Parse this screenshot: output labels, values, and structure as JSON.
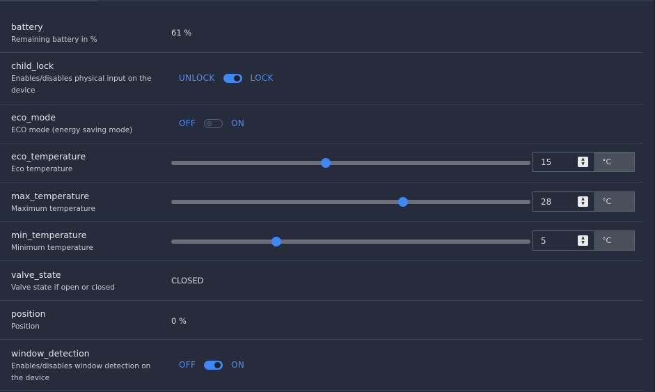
{
  "colors": {
    "background": "#262c3b",
    "accent": "#3e87f5",
    "divider": "#3c4354"
  },
  "rows": {
    "battery": {
      "name": "battery",
      "description": "Remaining battery in %",
      "value": "61 %"
    },
    "child_lock": {
      "name": "child_lock",
      "description_line1": "Enables/disables physical input on the",
      "description_line2": "device",
      "off_label": "UNLOCK",
      "on_label": "LOCK",
      "state": "on"
    },
    "eco_mode": {
      "name": "eco_mode",
      "description": "ECO mode (energy saving mode)",
      "off_label": "OFF",
      "on_label": "ON",
      "state": "off"
    },
    "eco_temperature": {
      "name": "eco_temperature",
      "description": "Eco temperature",
      "value": "15",
      "unit": "°C",
      "slider_fraction": 0.43
    },
    "max_temperature": {
      "name": "max_temperature",
      "description": "Maximum temperature",
      "value": "28",
      "unit": "°C",
      "slider_fraction": 0.646
    },
    "min_temperature": {
      "name": "min_temperature",
      "description": "Minimum temperature",
      "value": "5",
      "unit": "°C",
      "slider_fraction": 0.292
    },
    "valve_state": {
      "name": "valve_state",
      "description": "Valve state if open or closed",
      "value": "CLOSED"
    },
    "position": {
      "name": "position",
      "description": "Position",
      "value": "0 %"
    },
    "window_detection": {
      "name": "window_detection",
      "description_line1": "Enables/disables window detection on",
      "description_line2": "the device",
      "off_label": "OFF",
      "on_label": "ON",
      "state": "on"
    }
  }
}
